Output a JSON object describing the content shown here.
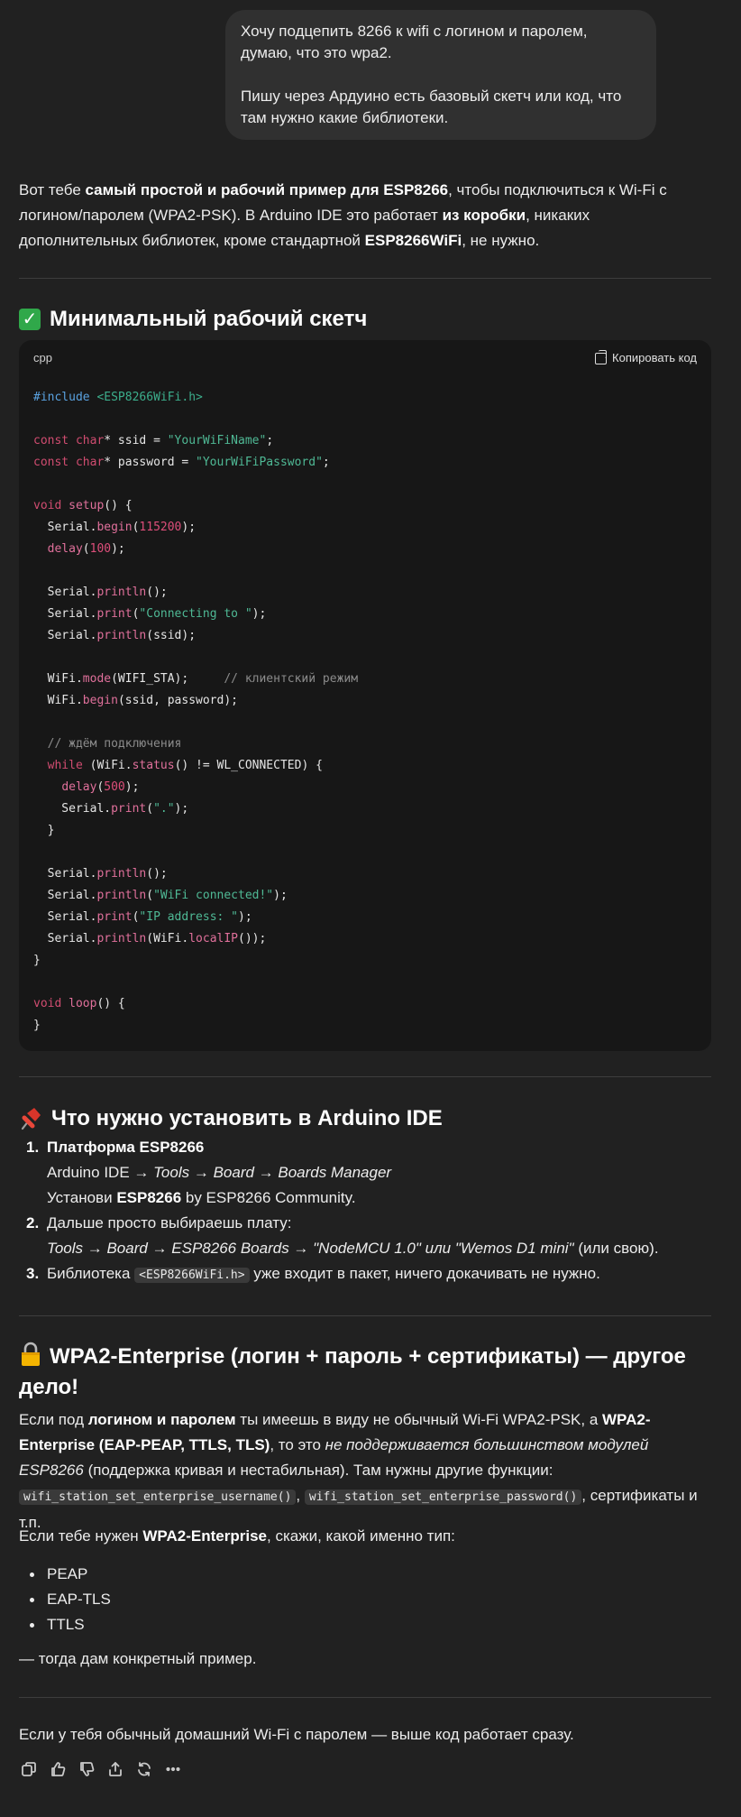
{
  "user_message": {
    "line1": "Хочу подцепить 8266 к wifi с логином и паролем, думаю, что это wpa2.",
    "line2": "Пишу через Ардуино есть базовый скетч или код, что там нужно какие библиотеки."
  },
  "intro": {
    "p1": "Вот тебе ",
    "b1": "самый простой и рабочий пример для ESP8266",
    "p2": ", чтобы подключиться к Wi-Fi с логином/паролем (WPA2-PSK). В Arduino IDE это работает ",
    "b2": "из коробки",
    "p3": ", никаких дополнительных библиотек, кроме стандартной ",
    "b3": "ESP8266WiFi",
    "p4": ", не нужно."
  },
  "section1": {
    "title": "Минимальный рабочий скетч",
    "icon": "check-mark-button-icon"
  },
  "codeblock": {
    "language": "cpp",
    "copy_label": "Копировать код"
  },
  "section2": {
    "title": "Что нужно установить в Arduino IDE",
    "icon": "pushpin-icon"
  },
  "steps": {
    "s1_title": "Платформа ESP8266",
    "s1_path_a": "Arduino IDE → ",
    "s1_path_b": "Tools → Board → Boards Manager",
    "s1_install_a": "Установи ",
    "s1_install_b": "ESP8266",
    "s1_install_c": " by ESP8266 Community.",
    "s2_text": "Дальше просто выбираешь плату:",
    "s2_path": "Tools → Board → ESP8266 Boards → \"NodeMCU 1.0\" или \"Wemos D1 mini\"",
    "s2_tail": " (или свою).",
    "s3_a": "Библиотека ",
    "s3_code": "<ESP8266WiFi.h>",
    "s3_b": " уже входит в пакет, ничего докачивать не нужно."
  },
  "section3": {
    "title": "WPA2-Enterprise (логин + пароль + сертификаты) — другое дело!",
    "icon": "lock-icon"
  },
  "enterprise": {
    "a": "Если под ",
    "b": "логином и паролем",
    "c": " ты имеешь в виду не обычный Wi-Fi WPA2-PSK, а ",
    "d": "WPA2-Enterprise (EAP-PEAP, TTLS, TLS)",
    "e": ", то это ",
    "f": "не поддерживается большинством модулей ESP8266",
    "g": " (поддержка кривая и нестабильная). Там нужны другие функции: ",
    "code1": "wifi_station_set_enterprise_username()",
    "h": ", ",
    "code2": "wifi_station_set_enterprise_password()",
    "i": ", сертификаты и т.п."
  },
  "ask": {
    "a": "Если тебе нужен ",
    "b": "WPA2-Enterprise",
    "c": ", скажи, какой именно тип:"
  },
  "options": [
    "PEAP",
    "EAP-TLS",
    "TTLS"
  ],
  "then_text": "— тогда дам конкретный пример.",
  "final_text": "Если у тебя обычный домашний Wi-Fi с паролем — выше код работает сразу.",
  "colors": {
    "background": "#212121",
    "bubble": "#303030",
    "code_bg": "#171717",
    "keyword": "#d04c70",
    "string": "#4fb995",
    "comment": "#8b8b8b"
  }
}
